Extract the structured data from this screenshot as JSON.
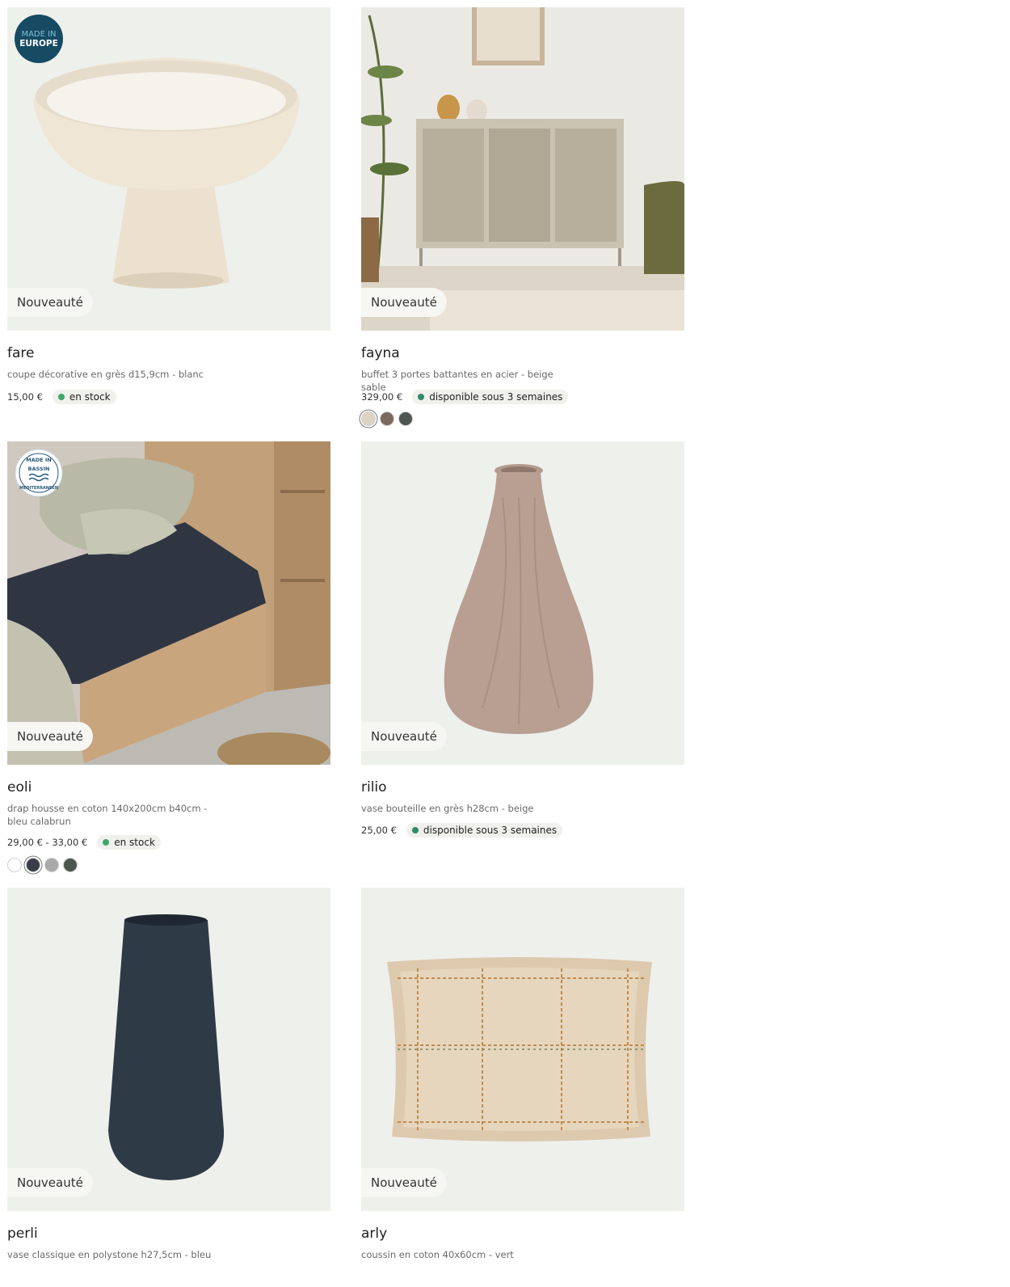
{
  "products": [
    {
      "name": "fare",
      "description": "coupe décorative en grès d15,9cm - blanc",
      "price": "15,00 €",
      "badge": "Nouveauté",
      "origin_badge": "MADE IN EUROPE",
      "availability": {
        "label": "en stock",
        "color": "#3fa66a"
      },
      "swatches": []
    },
    {
      "name": "fayna",
      "description": "buffet 3 portes battantes en acier - beige sable",
      "price": "329,00 €",
      "badge": "Nouveauté",
      "availability": {
        "label": "disponible sous 3 semaines",
        "color": "#2f8a6a"
      },
      "swatches": [
        "#dcd3c2",
        "#7a6a5e",
        "#4f5752"
      ]
    },
    {
      "name": "eoli",
      "description": "drap housse en coton 140x200cm b40cm - bleu calabrun",
      "price": "29,00 € - 33,00 €",
      "badge": "Nouveauté",
      "origin_badge": "MADE IN BASSIN MEDITERRANEEN",
      "availability": {
        "label": "en stock",
        "color": "#3fa66a"
      },
      "swatches": [
        "#ffffff",
        "#3a3d48",
        "#a9a9a9",
        "#4d554f"
      ]
    },
    {
      "name": "rilio",
      "description": "vase bouteille en grès h28cm - beige",
      "price": "25,00 €",
      "badge": "Nouveauté",
      "availability": {
        "label": "disponible sous 3 semaines",
        "color": "#2f8a6a"
      },
      "swatches": []
    },
    {
      "name": "perli",
      "description": "vase classique en polystone h27,5cm - bleu",
      "badge": "Nouveauté"
    },
    {
      "name": "arly",
      "description": "coussin en coton 40x60cm - vert",
      "badge": "Nouveauté"
    }
  ],
  "icons": {
    "bowl": "bowl-product-image",
    "sideboard": "sideboard-product-image",
    "bed": "bed-sheet-product-image",
    "bottle_vase": "bottle-vase-product-image",
    "tall_vase": "tall-vase-product-image",
    "cushion": "cushion-product-image"
  }
}
